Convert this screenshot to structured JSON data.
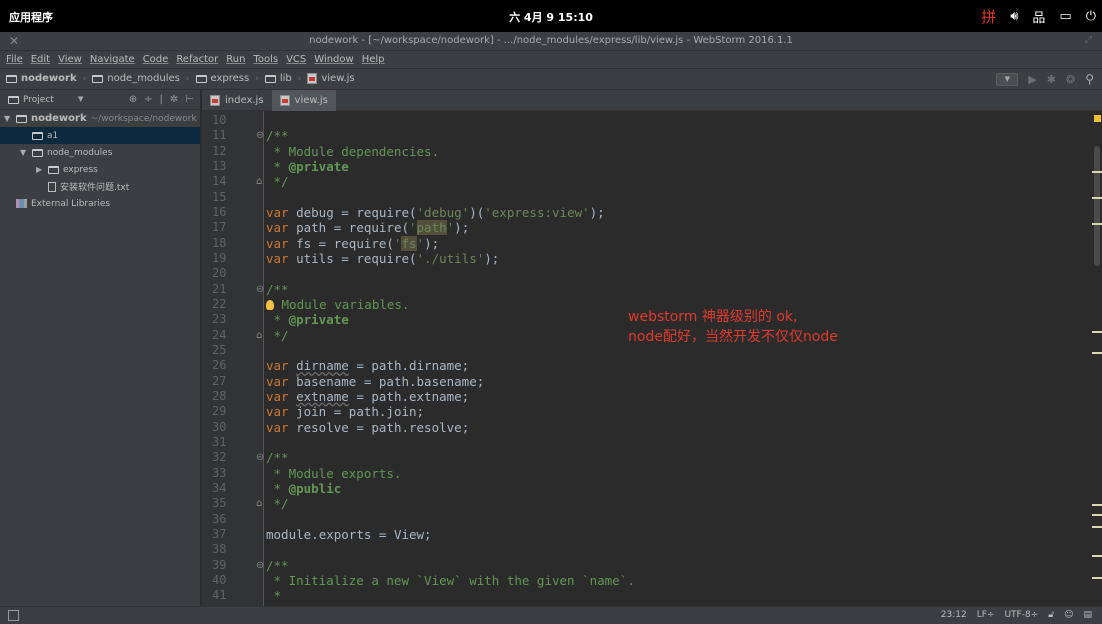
{
  "topbar": {
    "apps_label": "应用程序",
    "clock": "六 4月 9  15:10",
    "ime_icon": "拼",
    "tray_icons": [
      "volume-icon",
      "network-icon",
      "battery-icon",
      "power-icon"
    ]
  },
  "window": {
    "title": "nodework - [~/workspace/nodework] - .../node_modules/express/lib/view.js - WebStorm 2016.1.1"
  },
  "menu": [
    "File",
    "Edit",
    "View",
    "Navigate",
    "Code",
    "Refactor",
    "Run",
    "Tools",
    "VCS",
    "Window",
    "Help"
  ],
  "breadcrumbs": [
    {
      "label": "nodework",
      "type": "folder"
    },
    {
      "label": "node_modules",
      "type": "folder"
    },
    {
      "label": "express",
      "type": "folder"
    },
    {
      "label": "lib",
      "type": "folder"
    },
    {
      "label": "view.js",
      "type": "js"
    }
  ],
  "project_panel": {
    "title": "Project",
    "tree": [
      {
        "label": "nodework",
        "hint": "~/workspace/nodework",
        "indent": 0,
        "arrow": "▼",
        "icon": "folder"
      },
      {
        "label": "a1",
        "hint": "",
        "indent": 1,
        "arrow": "",
        "icon": "folder",
        "selected": true
      },
      {
        "label": "node_modules",
        "hint": "",
        "indent": 1,
        "arrow": "▼",
        "icon": "folder"
      },
      {
        "label": "express",
        "hint": "",
        "indent": 2,
        "arrow": "▶",
        "icon": "folder"
      },
      {
        "label": "安装软件问题.txt",
        "hint": "",
        "indent": 2,
        "arrow": "",
        "icon": "txt"
      },
      {
        "label": "External Libraries",
        "hint": "",
        "indent": 0,
        "arrow": "",
        "icon": "lib"
      }
    ]
  },
  "tabs": [
    {
      "label": "index.js",
      "active": false
    },
    {
      "label": "view.js",
      "active": true
    }
  ],
  "editor": {
    "line_numbers": [
      "10",
      "11",
      "12",
      "13",
      "14",
      "15",
      "16",
      "17",
      "18",
      "19",
      "20",
      "21",
      "22",
      "23",
      "24",
      "25",
      "26",
      "27",
      "28",
      "29",
      "30",
      "31",
      "32",
      "33",
      "34",
      "35",
      "36",
      "37",
      "38",
      "39",
      "40",
      "41"
    ],
    "lines": [
      [],
      [
        [
          "cm",
          "/**"
        ]
      ],
      [
        [
          "cm",
          " * Module dependencies."
        ]
      ],
      [
        [
          "cm",
          " * "
        ],
        [
          "tag",
          "@private"
        ]
      ],
      [
        [
          "cm",
          " */"
        ]
      ],
      [],
      [
        [
          "kw",
          "var "
        ],
        [
          "",
          "debug = require("
        ],
        [
          "str",
          "'debug'"
        ],
        [
          "",
          ")("
        ],
        [
          "str",
          "'express:view'"
        ],
        [
          "",
          ");"
        ]
      ],
      [
        [
          "kw",
          "var "
        ],
        [
          "",
          "path = require("
        ],
        [
          "str",
          "'"
        ],
        [
          "str hl",
          "path"
        ],
        [
          "str",
          "'"
        ],
        [
          "",
          ");"
        ]
      ],
      [
        [
          "kw",
          "var "
        ],
        [
          "",
          "fs = require("
        ],
        [
          "str",
          "'"
        ],
        [
          "str hl",
          "fs"
        ],
        [
          "str",
          "'"
        ],
        [
          "",
          ");"
        ]
      ],
      [
        [
          "kw",
          "var "
        ],
        [
          "",
          "utils = require("
        ],
        [
          "str",
          "'./utils'"
        ],
        [
          "",
          ");"
        ]
      ],
      [],
      [
        [
          "cm",
          "/**"
        ]
      ],
      [
        [
          "bulb",
          ""
        ],
        [
          "cm",
          " Module variables."
        ]
      ],
      [
        [
          "cm",
          " * "
        ],
        [
          "tag",
          "@private"
        ]
      ],
      [
        [
          "cm",
          " */"
        ]
      ],
      [],
      [
        [
          "kw",
          "var "
        ],
        [
          "wavy",
          "dirname"
        ],
        [
          "",
          " = path.dirname;"
        ]
      ],
      [
        [
          "kw",
          "var "
        ],
        [
          "",
          "basename = path.basename;"
        ]
      ],
      [
        [
          "kw",
          "var "
        ],
        [
          "wavy",
          "extname"
        ],
        [
          "",
          " = path.extname;"
        ]
      ],
      [
        [
          "kw",
          "var "
        ],
        [
          "",
          "join = path.join;"
        ]
      ],
      [
        [
          "kw",
          "var "
        ],
        [
          "",
          "resolve = path."
        ],
        [
          "",
          "resolve"
        ],
        [
          "",
          ";"
        ]
      ],
      [],
      [
        [
          "cm",
          "/**"
        ]
      ],
      [
        [
          "cm",
          " * Module exports."
        ]
      ],
      [
        [
          "cm",
          " * "
        ],
        [
          "tag",
          "@public"
        ]
      ],
      [
        [
          "cm",
          " */"
        ]
      ],
      [],
      [
        [
          "",
          "module."
        ],
        [
          "",
          "exports"
        ],
        [
          "",
          " = View;"
        ]
      ],
      [],
      [
        [
          "cm",
          "/**"
        ]
      ],
      [
        [
          "cm",
          " * Initialize a new `View` with the given `name`."
        ]
      ],
      [
        [
          "cm",
          " *"
        ]
      ]
    ]
  },
  "annotation": {
    "line1": "webstorm 神器级别的 ok,",
    "line2": "node配好，当然开发不仅仅node"
  },
  "statusbar": {
    "position": "23:12",
    "line_sep": "LF÷",
    "encoding": "UTF-8÷"
  },
  "colors": {
    "keyword": "#cc7832",
    "string": "#6a8759",
    "comment": "#629755",
    "annotation": "#e03a2d"
  }
}
